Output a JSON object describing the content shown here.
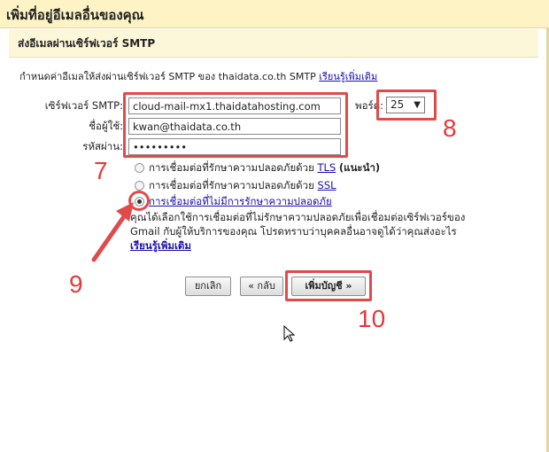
{
  "window": {
    "title": "เพิ่มที่อยู่อีเมลอื่นของคุณ"
  },
  "section": {
    "title": "ส่งอีเมลผ่านเซิร์ฟเวอร์ SMTP"
  },
  "intro": {
    "text": "กำหนดค่าอีเมลให้ส่งผ่านเซิร์ฟเวอร์ SMTP ของ thaidata.co.th SMTP",
    "link": "เรียนรู้เพิ่มเติม"
  },
  "form": {
    "server_label": "เซิร์ฟเวอร์ SMTP:",
    "server_value": "cloud-mail-mx1.thaidatahosting.com",
    "user_label": "ชื่อผู้ใช้:",
    "user_value": "kwan@thaidata.co.th",
    "password_label": "รหัสผ่าน:",
    "password_value": "•••••••••",
    "port_label": "พอร์ต:",
    "port_value": "25"
  },
  "security": {
    "tls_text": "การเชื่อมต่อที่รักษาความปลอดภัยด้วย",
    "tls_link": "TLS",
    "tls_note": "(แนะนำ)",
    "ssl_text": "การเชื่อมต่อที่รักษาความปลอดภัยด้วย",
    "ssl_link": "SSL",
    "insecure_link": "การเชื่อมต่อที่ไม่มีการรักษาความปลอดภัย",
    "warning_line1": "คุณได้เลือกใช้การเชื่อมต่อที่ไม่รักษาความปลอดภัยเพื่อเชื่อมต่อเซิร์ฟเวอร์ของ",
    "warning_line2": "Gmail กับผู้ให้บริการของคุณ โปรดทราบว่าบุคคลอื่นอาจดูได้ว่าคุณส่งอะไร",
    "warning_link": "เรียนรู้เพิ่มเติม"
  },
  "buttons": {
    "cancel": "ยกเลิก",
    "back": "« กลับ",
    "add_account": "เพิ่มบัญชี »"
  },
  "annotations": {
    "n7": "7",
    "n8": "8",
    "n9": "9",
    "n10": "10"
  },
  "colors": {
    "annotation": "#e04a4a",
    "link": "#1a0dab",
    "title_bg": "#fdf3c5"
  }
}
